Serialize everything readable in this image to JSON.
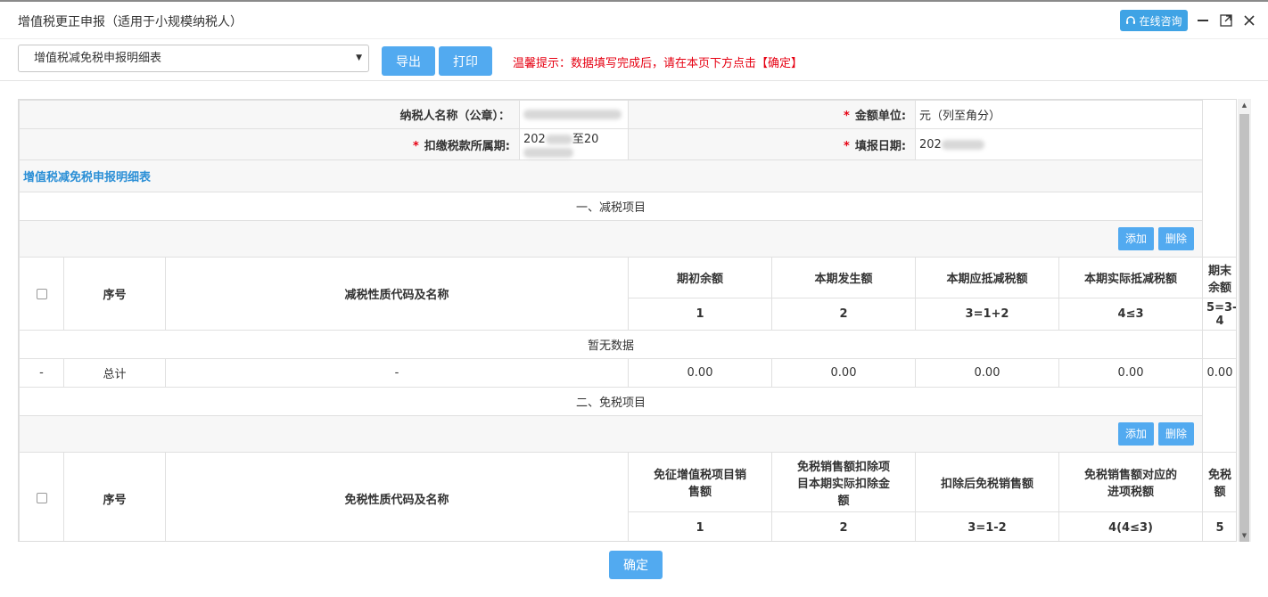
{
  "window": {
    "title": "增值税更正申报（适用于小规模纳税人）",
    "consult_label": "在线咨询"
  },
  "toolbar": {
    "select_value": "增值税减免税申报明细表",
    "export_label": "导出",
    "print_label": "打印",
    "tip": "温馨提示：数据填写完成后，请在本页下方点击【确定】"
  },
  "header": {
    "taxpayer_label": "纳税人名称（公章）：",
    "taxpayer_value": "",
    "unit_label": "金额单位:",
    "unit_value": "元（列至角分）",
    "period_label": "扣缴税款所属期:",
    "period_prefix": "202",
    "period_mid": "至20",
    "fill_date_label": "填报日期:",
    "fill_date_prefix": "202"
  },
  "section_title": "增值税减免税申报明细表",
  "reduction": {
    "title": "一、减税项目",
    "add_label": "添加",
    "delete_label": "删除",
    "headers": {
      "seq": "序号",
      "code": "减税性质代码及名称",
      "c1": "期初余额",
      "c2": "本期发生额",
      "c3": "本期应抵减税额",
      "c4": "本期实际抵减税额",
      "c5": "期末余额"
    },
    "col_numbers": [
      "1",
      "2",
      "3=1+2",
      "4≤3",
      "5=3-4"
    ],
    "empty_text": "暂无数据",
    "total": {
      "dash1": "-",
      "label": "总计",
      "dash2": "-",
      "values": [
        "0.00",
        "0.00",
        "0.00",
        "0.00",
        "0.00"
      ]
    }
  },
  "exemption": {
    "title": "二、免税项目",
    "add_label": "添加",
    "delete_label": "删除",
    "headers": {
      "seq": "序号",
      "code": "免税性质代码及名称",
      "c1": "免征增值税项目销售额",
      "c2": "免税销售额扣除项目本期实际扣除金额",
      "c3": "扣除后免税销售额",
      "c4": "免税销售额对应的进项税额",
      "c5": "免税额"
    },
    "col_numbers": [
      "1",
      "2",
      "3=1-2",
      "4(4≤3)",
      "5"
    ]
  },
  "confirm_label": "确定",
  "colors": {
    "accent": "#52aaf0",
    "warning": "#e60012",
    "section": "#2b8fd6"
  }
}
